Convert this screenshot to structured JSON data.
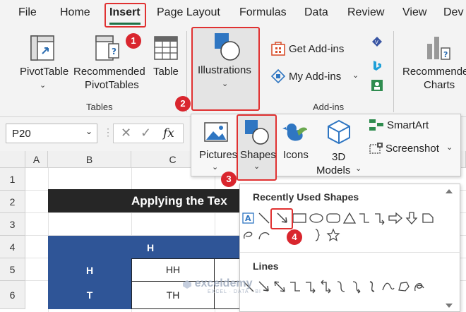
{
  "tabs": [
    "File",
    "Home",
    "Insert",
    "Page Layout",
    "Formulas",
    "Data",
    "Review",
    "View",
    "Dev"
  ],
  "ribbon": {
    "pivot_table": "PivotTable",
    "recommended_pivot_1": "Recommended",
    "recommended_pivot_2": "PivotTables",
    "table": "Table",
    "tables_group": "Tables",
    "illustrations": "Illustrations",
    "get_addins": "Get Add-ins",
    "my_addins": "My Add-ins",
    "addins_group": "Add-ins",
    "recommended_charts_1": "Recommende",
    "recommended_charts_2": "Charts"
  },
  "formula_bar": {
    "name_box": "P20",
    "fx": "fx"
  },
  "columns": [
    "A",
    "B",
    "C"
  ],
  "rows": [
    "1",
    "2",
    "3",
    "4",
    "5",
    "6"
  ],
  "sheet": {
    "title": "Applying the Tex",
    "header_h": "H",
    "row5_label": "H",
    "row5_value": "HH",
    "row6_label": "T",
    "row6_value": "TH"
  },
  "illustrations_menu": {
    "pictures": "Pictures",
    "shapes": "Shapes",
    "icons": "Icons",
    "models_1": "3D",
    "models_2": "Models",
    "smartart": "SmartArt",
    "screenshot": "Screenshot"
  },
  "shapes_gallery": {
    "recent_header": "Recently Used Shapes",
    "lines_header": "Lines"
  },
  "badges": [
    "1",
    "2",
    "3",
    "4"
  ],
  "watermark": {
    "brand": "exceldemy",
    "tagline": "EXCEL · DATA · BI"
  },
  "colors": {
    "accent_green": "#1e7145",
    "highlight_red": "#e03131",
    "table_blue": "#2f5597",
    "title_black": "#262626"
  }
}
